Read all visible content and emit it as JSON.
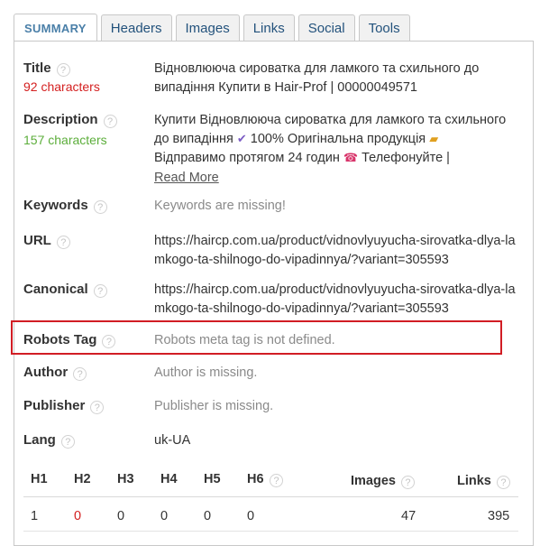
{
  "tabs": [
    {
      "label": "SUMMARY",
      "active": true
    },
    {
      "label": "Headers"
    },
    {
      "label": "Images"
    },
    {
      "label": "Links"
    },
    {
      "label": "Social"
    },
    {
      "label": "Tools"
    }
  ],
  "help_glyph": "?",
  "summary": {
    "title": {
      "label": "Title",
      "count": "92 characters",
      "value": "Відновлююча сироватка для ламкого та схильного до випадіння Купити в Hair-Prof | 00000049571"
    },
    "description": {
      "label": "Description",
      "count": "157 characters",
      "line1": "Купити Відновлююча сироватка для ламкого та схильного",
      "line2a": "до випадіння",
      "line2b": "100% Оригінальна продукція",
      "line3a": "Відправимо протягом 24 годин",
      "line3b": "Телефонуйте |",
      "read_more": "Read More"
    },
    "keywords": {
      "label": "Keywords",
      "value": "Keywords are missing!"
    },
    "url": {
      "label": "URL",
      "value": "https://haircp.com.ua/product/vidnovlyuyucha-sirovatka-dlya-lamkogo-ta-shilnogo-do-vipadinnya/?variant=305593"
    },
    "canonical": {
      "label": "Canonical",
      "value": "https://haircp.com.ua/product/vidnovlyuyucha-sirovatka-dlya-lamkogo-ta-shilnogo-do-vipadinnya/?variant=305593"
    },
    "robots": {
      "label": "Robots Tag",
      "value": "Robots meta tag is not defined."
    },
    "author": {
      "label": "Author",
      "value": "Author is missing."
    },
    "publisher": {
      "label": "Publisher",
      "value": "Publisher is missing."
    },
    "lang": {
      "label": "Lang",
      "value": "uk-UA"
    }
  },
  "counts": {
    "headers": [
      "H1",
      "H2",
      "H3",
      "H4",
      "H5",
      "H6"
    ],
    "values": [
      "1",
      "0",
      "0",
      "0",
      "0",
      "0"
    ],
    "images_label": "Images",
    "images_value": "47",
    "links_label": "Links",
    "links_value": "395"
  },
  "colors": {
    "accent": "#4a7fa8",
    "warning": "#d42020",
    "ok": "#5cae3b",
    "highlight": "#d11d24"
  }
}
